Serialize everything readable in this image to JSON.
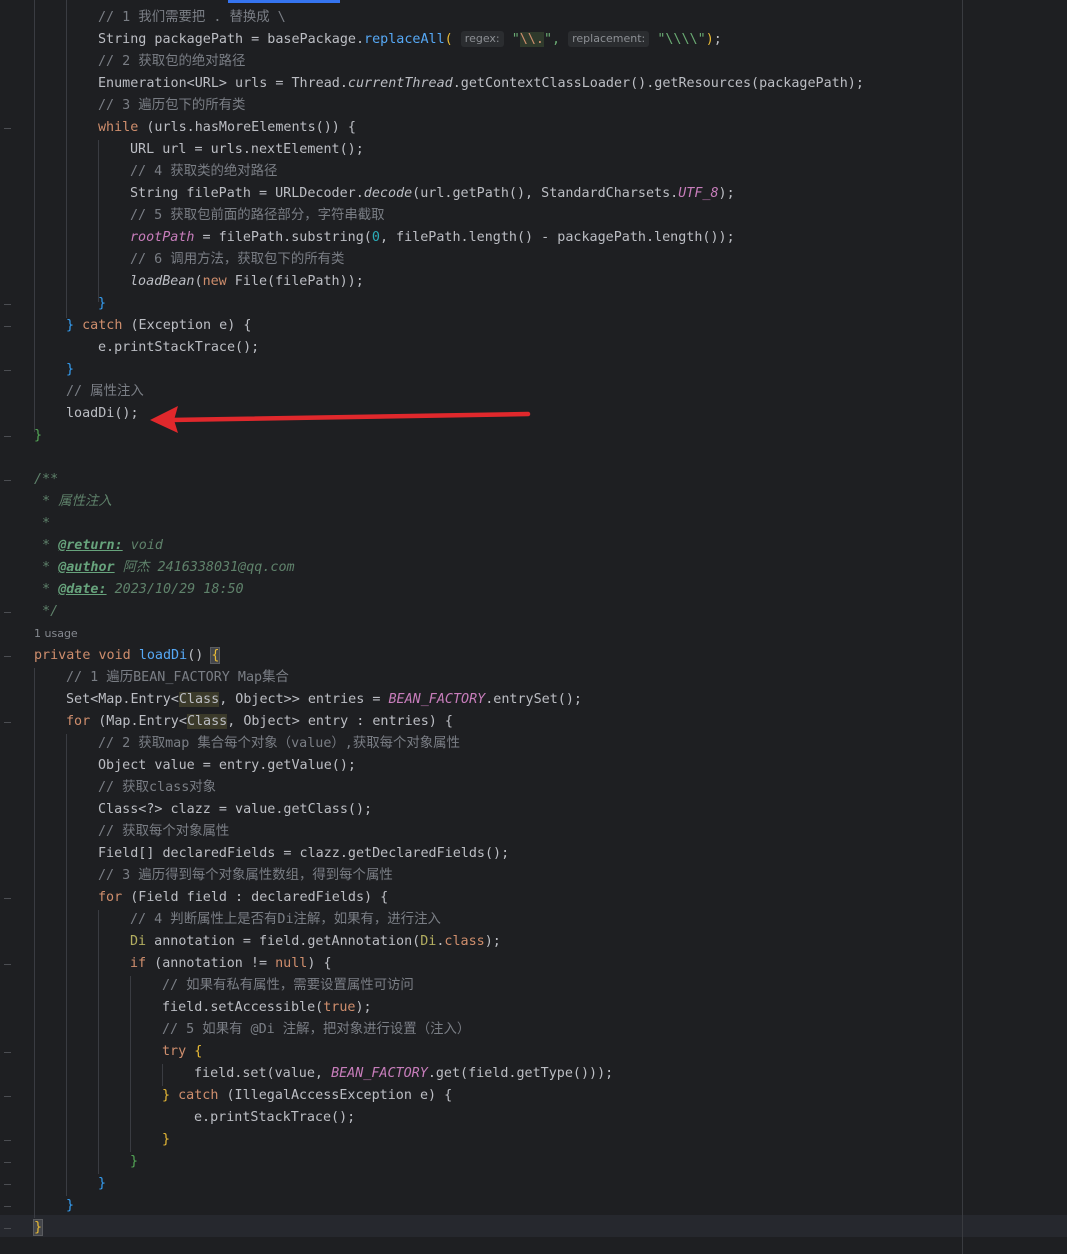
{
  "editor": {
    "usage_hint": "1 usage",
    "hint_regex": "regex:",
    "hint_replacement": "replacement:"
  },
  "code": {
    "l1_comment": "// 1 我们需要把 . 替换成 \\",
    "l2_a": "String packagePath = basePackage.",
    "l2_m": "replaceAll",
    "l2_s1": "\"",
    "l2_esc": "\\\\.",
    "l2_s2": "\",",
    "l2_s3": "\"\\\\\\\\\"",
    "l3_comment": "// 2 获取包的绝对路径",
    "l4_text": "Enumeration<URL> urls = Thread.",
    "l4_it": "currentThread",
    "l4_rest": ".getContextClassLoader().getResources(packagePath);",
    "l5_comment": "// 3 遍历包下的所有类",
    "l6_kw": "while",
    "l6_rest": " (urls.hasMoreElements()) {",
    "l7": "URL url = urls.nextElement();",
    "l8_comment": "// 4 获取类的绝对路径",
    "l9_a": "String filePath = URLDecoder.",
    "l9_it": "decode",
    "l9_b": "(url.getPath(), StandardCharsets.",
    "l9_sf": "UTF_8",
    "l9_c": ");",
    "l10_comment": "// 5 获取包前面的路径部分，字符串截取",
    "l11_sf": "rootPath",
    "l11_a": " = filePath.substring(",
    "l11_num": "0",
    "l11_b": ", filePath.length() - packagePath.length());",
    "l12_comment": "// 6 调用方法，获取包下的所有类",
    "l13_it": "loadBean",
    "l13_a": "(",
    "l13_kw": "new",
    "l13_b": " File(filePath));",
    "l14": "}",
    "l15_a": "} ",
    "l15_kw": "catch",
    "l15_b": " (Exception e) {",
    "l16": "e.printStackTrace();",
    "l17": "}",
    "l18_comment": "// 属性注入",
    "l19": "loadDi();",
    "l20": "}",
    "d1": "/**",
    "d2": " * 属性注入",
    "d3": " *",
    "d4_a": " * ",
    "d4_tag": "@return:",
    "d4_b": " void",
    "d5_a": " * ",
    "d5_tag": "@author",
    "d5_b": " 阿杰 2416338031@qq.com",
    "d6_a": " * ",
    "d6_tag": "@date:",
    "d6_b": " 2023/10/29 18:50",
    "d7": " */",
    "m1_kw": "private void",
    "m1_fn": "loadDi",
    "m1_rest": "() ",
    "m1_brace": "{",
    "m2_comment": "// 1 遍历BEAN_FACTORY Map集合",
    "m3_a": "Set<Map.Entry<",
    "m3_gen": "Class",
    "m3_b": ", Object>> entries = ",
    "m3_sf": "BEAN_FACTORY",
    "m3_c": ".entrySet();",
    "m4_kw": "for",
    "m4_a": " (Map.Entry<",
    "m4_gen": "Class",
    "m4_b": ", Object> entry : entries) {",
    "m5_comment": "// 2 获取map 集合每个对象（value）,获取每个对象属性",
    "m6": "Object value = entry.getValue();",
    "m7_comment": "// 获取class对象",
    "m8": "Class<?> clazz = value.getClass();",
    "m9_comment": "// 获取每个对象属性",
    "m10": "Field[] declaredFields = clazz.getDeclaredFields();",
    "m11_comment": "// 3 遍历得到每个对象属性数组，得到每个属性",
    "m12_kw": "for",
    "m12_rest": " (Field field : declaredFields) {",
    "m13_comment": "// 4 判断属性上是否有Di注解，如果有，进行注入",
    "m14_ann": "Di",
    "m14_a": " annotation = field.getAnnotation(",
    "m14_ann2": "Di",
    "m14_b": ".",
    "m14_kw": "class",
    "m14_c": ");",
    "m15_kw": "if",
    "m15_a": " (annotation != ",
    "m15_kw2": "null",
    "m15_b": ") {",
    "m16_comment": "// 如果有私有属性，需要设置属性可访问",
    "m17_a": "field.setAccessible(",
    "m17_kw": "true",
    "m17_b": ");",
    "m18_comment": "// 5 如果有 @Di 注解，把对象进行设置（注入）",
    "m19_kw": "try",
    "m19_rest": " {",
    "m20_a": "field.set(value, ",
    "m20_sf": "BEAN_FACTORY",
    "m20_b": ".get(field.getType()));",
    "m21_a": "} ",
    "m21_kw": "catch",
    "m21_b": " (IllegalAccessException e) {",
    "m22": "e.printStackTrace();",
    "m23": "}",
    "m24": "}",
    "m25": "}",
    "m26": "}",
    "m27": "}"
  },
  "colors": {
    "background": "#1e1f22",
    "keyword": "#cf8e6d",
    "comment": "#7a7e85",
    "string": "#6aab73",
    "static_field": "#c77dbb",
    "arrow": "#e0282c",
    "tab_indicator": "#3574f0"
  },
  "annotation_arrow": "red-arrow-pointing-left"
}
